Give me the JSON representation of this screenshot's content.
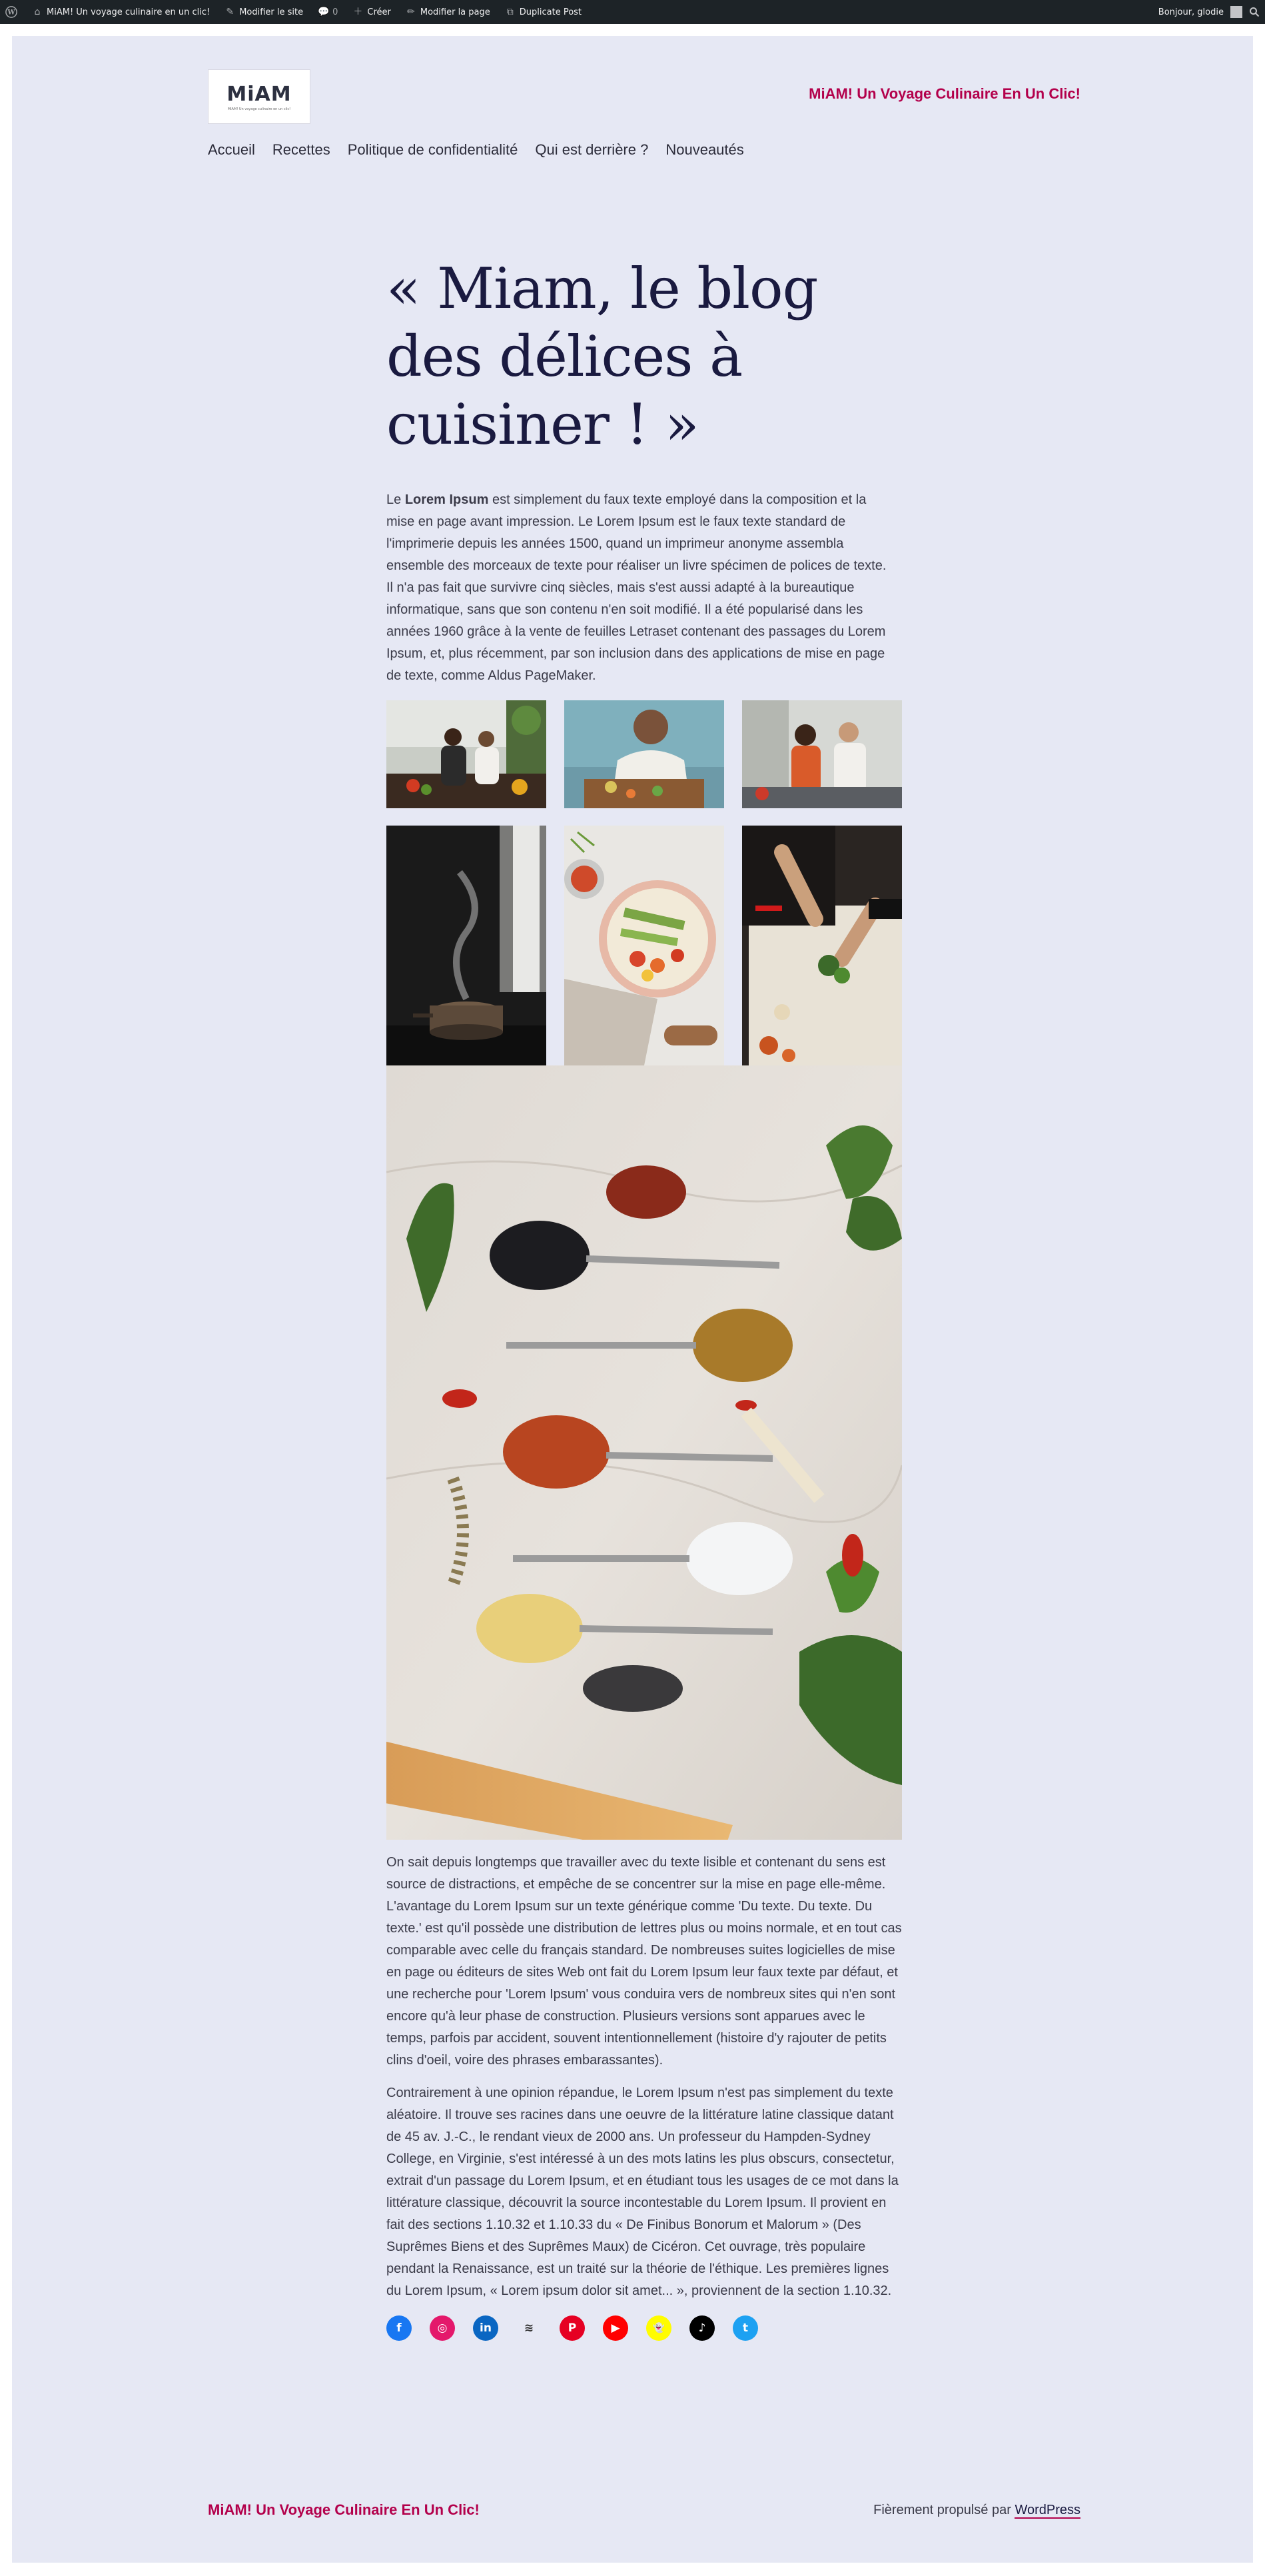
{
  "admin_bar": {
    "wp_logo_icon": "wordpress-icon",
    "site_name": "MiAM! Un voyage culinaire en un clic!",
    "edit_site": "Modifier le site",
    "comments_count": "0",
    "create": "Créer",
    "edit_page": "Modifier la page",
    "duplicate_post": "Duplicate Post",
    "greeting": "Bonjour, glodie"
  },
  "header": {
    "logo_text": "MiAM",
    "logo_subtext": "MiAM! Un voyage culinaire en un clic!",
    "site_title": "MiAM! Un Voyage Culinaire En Un Clic!"
  },
  "nav": {
    "items": [
      {
        "label": "Accueil"
      },
      {
        "label": "Recettes"
      },
      {
        "label": "Politique de confidentialité"
      },
      {
        "label": "Qui est derrière ?"
      },
      {
        "label": "Nouveautés"
      }
    ]
  },
  "main": {
    "title": "« Miam, le blog des délices à cuisiner ! »",
    "intro_bold": "Lorem Ipsum",
    "intro_prefix": "Le ",
    "intro_rest": " est simplement du faux texte employé dans la composition et la mise en page avant impression. Le Lorem Ipsum est le faux texte standard de l'imprimerie depuis les années 1500, quand un imprimeur anonyme assembla ensemble des morceaux de texte pour réaliser un livre spécimen de polices de texte. Il n'a pas fait que survivre cinq siècles, mais s'est aussi adapté à la bureautique informatique, sans que son contenu n'en soit modifié. Il a été popularisé dans les années 1960 grâce à la vente de feuilles Letraset contenant des passages du Lorem Ipsum, et, plus récemment, par son inclusion dans des applications de mise en page de texte, comme Aldus PageMaker.",
    "paragraph_2": "On sait depuis longtemps que travailler avec du texte lisible et contenant du sens est source de distractions, et empêche de se concentrer sur la mise en page elle-même. L'avantage du Lorem Ipsum sur un texte générique comme 'Du texte. Du texte. Du texte.' est qu'il possède une distribution de lettres plus ou moins normale, et en tout cas comparable avec celle du français standard. De nombreuses suites logicielles de mise en page ou éditeurs de sites Web ont fait du Lorem Ipsum leur faux texte par défaut, et une recherche pour 'Lorem Ipsum' vous conduira vers de nombreux sites qui n'en sont encore qu'à leur phase de construction. Plusieurs versions sont apparues avec le temps, parfois par accident, souvent intentionnellement (histoire d'y rajouter de petits clins d'oeil, voire des phrases embarassantes).",
    "paragraph_3": "Contrairement à une opinion répandue, le Lorem Ipsum n'est pas simplement du texte aléatoire. Il trouve ses racines dans une oeuvre de la littérature latine classique datant de 45 av. J.-C., le rendant vieux de 2000 ans. Un professeur du Hampden-Sydney College, en Virginie, s'est intéressé à un des mots latins les plus obscurs, consectetur, extrait d'un passage du Lorem Ipsum, et en étudiant tous les usages de ce mot dans la littérature classique, découvrit la source incontestable du Lorem Ipsum. Il provient en fait des sections 1.10.32 et 1.10.33 du « De Finibus Bonorum et Malorum » (Des Suprêmes Biens et des Suprêmes Maux) de Cicéron. Cet ouvrage, très populaire pendant la Renaissance, est un traité sur la théorie de l'éthique. Les premières lignes du Lorem Ipsum, « Lorem ipsum dolor sit amet... », proviennent de la section 1.10.32."
  },
  "gallery": [
    {
      "name": "photo-couple-cooking"
    },
    {
      "name": "photo-woman-chopping"
    },
    {
      "name": "photo-couple-kitchen"
    },
    {
      "name": "photo-steaming-pot"
    },
    {
      "name": "photo-rice-bowl"
    },
    {
      "name": "photo-chopping-herbs"
    }
  ],
  "featured_image": {
    "name": "photo-spice-spoons"
  },
  "social": [
    {
      "name": "facebook-icon",
      "color": "#1877f2",
      "glyph": "f"
    },
    {
      "name": "instagram-icon",
      "color": "#e4186b",
      "glyph": "◎"
    },
    {
      "name": "linkedin-icon",
      "color": "#0a66c2",
      "glyph": "in"
    },
    {
      "name": "rss-icon",
      "color": "#e6e8f4",
      "glyph": "≋"
    },
    {
      "name": "pinterest-icon",
      "color": "#e60023",
      "glyph": "P"
    },
    {
      "name": "youtube-icon",
      "color": "#ff0000",
      "glyph": "▶"
    },
    {
      "name": "snapchat-icon",
      "color": "#fffc00",
      "glyph": "👻"
    },
    {
      "name": "tiktok-icon",
      "color": "#000000",
      "glyph": "♪"
    },
    {
      "name": "twitter-icon",
      "color": "#1da1f2",
      "glyph": "t"
    }
  ],
  "footer": {
    "site_title": "MiAM! Un Voyage Culinaire En Un Clic!",
    "credit_prefix": "Fièrement propulsé par ",
    "credit_link": "WordPress"
  },
  "colors": {
    "accent": "#b3004b",
    "background": "#e6e8f4",
    "heading": "#1a1a40"
  }
}
